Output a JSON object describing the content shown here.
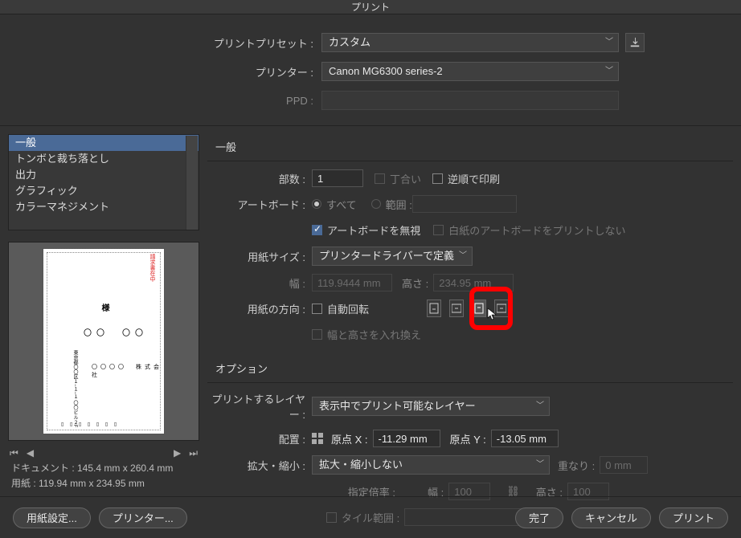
{
  "window_title": "プリント",
  "top": {
    "preset_label": "プリントプリセット :",
    "preset_value": "カスタム",
    "printer_label": "プリンター :",
    "printer_value": "Canon MG6300 series-2",
    "ppd_label": "PPD :"
  },
  "left": {
    "list": [
      "一般",
      "トンボと裁ち落とし",
      "出力",
      "グラフィック",
      "カラーマネジメント"
    ],
    "nav_first": "⏮",
    "nav_prev": "◀",
    "nav_next": "▶",
    "nav_last": "⏭",
    "doc_line": "ドキュメント : 145.4 mm x 260.4 mm",
    "media_line": "用紙 : 119.94 mm x 234.95 mm"
  },
  "general": {
    "section_title": "一般",
    "copies_label": "部数 :",
    "copies_value": "1",
    "collate_label": "丁合い",
    "reverse_label": "逆順で印刷",
    "artboard_label": "アートボード :",
    "artboard_all": "すべて",
    "artboard_range": "範囲 :",
    "ignore_artboards": "アートボードを無視",
    "skip_blank": "白紙のアートボードをプリントしない",
    "media_label": "用紙サイズ :",
    "media_value": "プリンタードライバーで定義",
    "width_label": "幅 :",
    "width_value": "119.9444 mm",
    "height_label": "高さ :",
    "height_value": "234.95 mm",
    "orient_label": "用紙の方向 :",
    "auto_rotate": "自動回転",
    "transverse": "幅と高さを入れ換え"
  },
  "options": {
    "section_title": "オプション",
    "layers_label": "プリントするレイヤー :",
    "layers_value": "表示中でプリント可能なレイヤー",
    "place_label": "配置 :",
    "origin_x_label": "原点 X :",
    "origin_x_value": "-11.29 mm",
    "origin_y_label": "原点 Y :",
    "origin_y_value": "-13.05 mm",
    "scale_label": "拡大・縮小 :",
    "scale_value": "拡大・縮小しない",
    "overlap_label": "重なり :",
    "overlap_value": "0 mm",
    "scale_pct_label": "指定倍率 :",
    "scale_w_label": "幅 :",
    "scale_w_value": "100",
    "scale_h_label": "高さ :",
    "scale_h_value": "100",
    "tile_label": "タイル範囲 :"
  },
  "footer": {
    "page_setup": "用紙設定...",
    "printer": "プリンター...",
    "done": "完了",
    "cancel": "キャンセル",
    "print": "プリント"
  }
}
